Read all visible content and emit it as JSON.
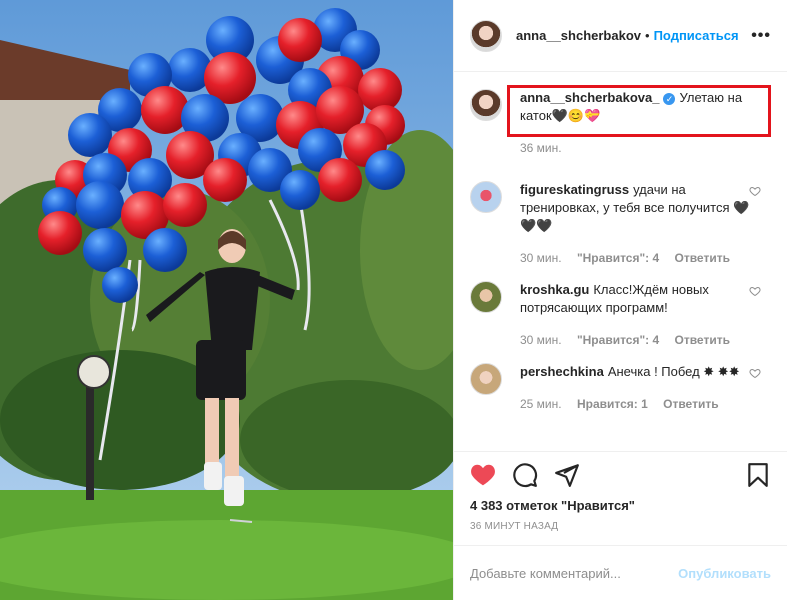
{
  "header": {
    "username": "anna__shcherbakov",
    "separator": "•",
    "follow_label": "Подписаться",
    "more_label": "•••"
  },
  "caption": {
    "username": "anna__shcherbakova_",
    "verified_glyph": "✓",
    "text": "Улетаю на каток🖤😊💝",
    "time": "36 мин."
  },
  "comments": [
    {
      "username": "figureskatingruss",
      "text": "удачи на тренировках, у тебя все получится 🖤🖤🖤",
      "time": "30 мин.",
      "likes": "\"Нравится\": 4",
      "reply": "Ответить"
    },
    {
      "username": "kroshka.gu",
      "text": "Класс!Ждём новых потрясающих программ!",
      "time": "30 мин.",
      "likes": "\"Нравится\": 4",
      "reply": "Ответить"
    },
    {
      "username": "pershechkina",
      "text": "Анечка ! Побед ✸ ✸✸",
      "time": "25 мин.",
      "likes": "Нравится: 1",
      "reply": "Ответить"
    }
  ],
  "post": {
    "likes_count": "4 383 отметок \"Нравится\"",
    "time_ago": "36 МИНУТ НАЗАД"
  },
  "composer": {
    "placeholder": "Добавьте комментарий...",
    "publish_label": "Опубликовать"
  },
  "icons": [
    "heart-filled-icon",
    "comment-icon",
    "share-icon",
    "bookmark-icon",
    "heart-outline-icon",
    "verified-icon"
  ],
  "colors": {
    "like_red": "#ed4956",
    "link_blue": "#0095f6",
    "publish_disabled": "#b2dffc",
    "highlight_box": "#e3141c"
  }
}
